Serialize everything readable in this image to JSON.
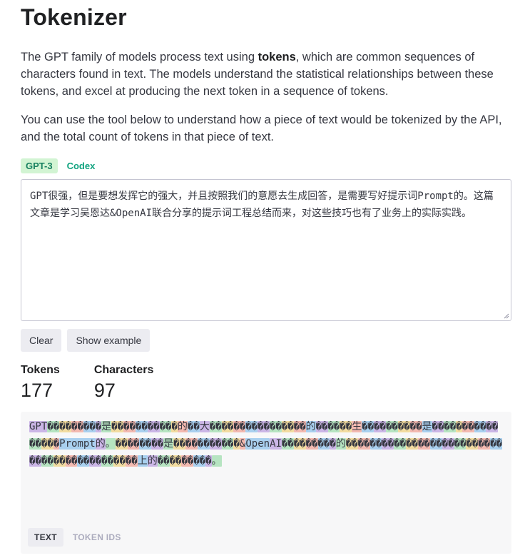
{
  "page": {
    "title": "Tokenizer",
    "intro_before": "The GPT family of models process text using ",
    "intro_bold": "tokens",
    "intro_after": ", which are common sequences of characters found in text. The models understand the statistical relationships between these tokens, and excel at producing the next token in a sequence of tokens.",
    "intro2": "You can use the tool below to understand how a piece of text would be tokenized by the API, and the total count of tokens in that piece of text."
  },
  "models": {
    "tabs": [
      "GPT-3",
      "Codex"
    ],
    "active": "GPT-3"
  },
  "input": {
    "value": "GPT很强，但是要想发挥它的强大，并且按照我们的意愿去生成回答，是需要写好提示词Prompt的。这篇文章是学习吴恩达&OpenAI联合分享的提示词工程总结而来，对这些技巧也有了业务上的实际实践。"
  },
  "buttons": {
    "clear": "Clear",
    "show_example": "Show example"
  },
  "stats": {
    "tokens_label": "Tokens",
    "tokens_value": "177",
    "characters_label": "Characters",
    "characters_value": "97"
  },
  "tokens": [
    "GPT",
    "��",
    "��",
    "��",
    "��",
    "�",
    "是",
    "��",
    "��",
    "��",
    "��",
    "��",
    "�",
    "的",
    "��",
    "大",
    "��",
    "��",
    "��",
    "��",
    "��",
    "��",
    "��",
    "��",
    "的",
    "��",
    "��",
    "��",
    "生",
    "��",
    "��",
    "��",
    "��",
    "��",
    "是",
    "��",
    "��",
    "�",
    "��",
    "��",
    "��",
    "��",
    "��",
    "�",
    "Prompt",
    "的",
    "。",
    "��",
    "��",
    "��",
    "��",
    "是",
    "��",
    "��",
    "��",
    "��",
    "��",
    "�",
    "&",
    "Open",
    "AI",
    "��",
    "��",
    "��",
    "��",
    "�",
    "的",
    "��",
    "��",
    "��",
    "��",
    "��",
    "��",
    "��",
    "��",
    "��",
    "��",
    "��",
    "��",
    "��",
    "��",
    "��",
    "��",
    "��",
    "��",
    "��",
    "��",
    "��",
    "��",
    "上",
    "的",
    "��",
    "��",
    "��",
    "��",
    "�",
    "。"
  ],
  "view_tabs": {
    "text": "TEXT",
    "token_ids": "TOKEN IDS",
    "active": "TEXT"
  },
  "colors": {
    "accent": "#10a37f",
    "token_palette": [
      "#cbb6e6",
      "#b6e4c1",
      "#f2dca0",
      "#f3b9b0",
      "#a9d0ef"
    ]
  }
}
